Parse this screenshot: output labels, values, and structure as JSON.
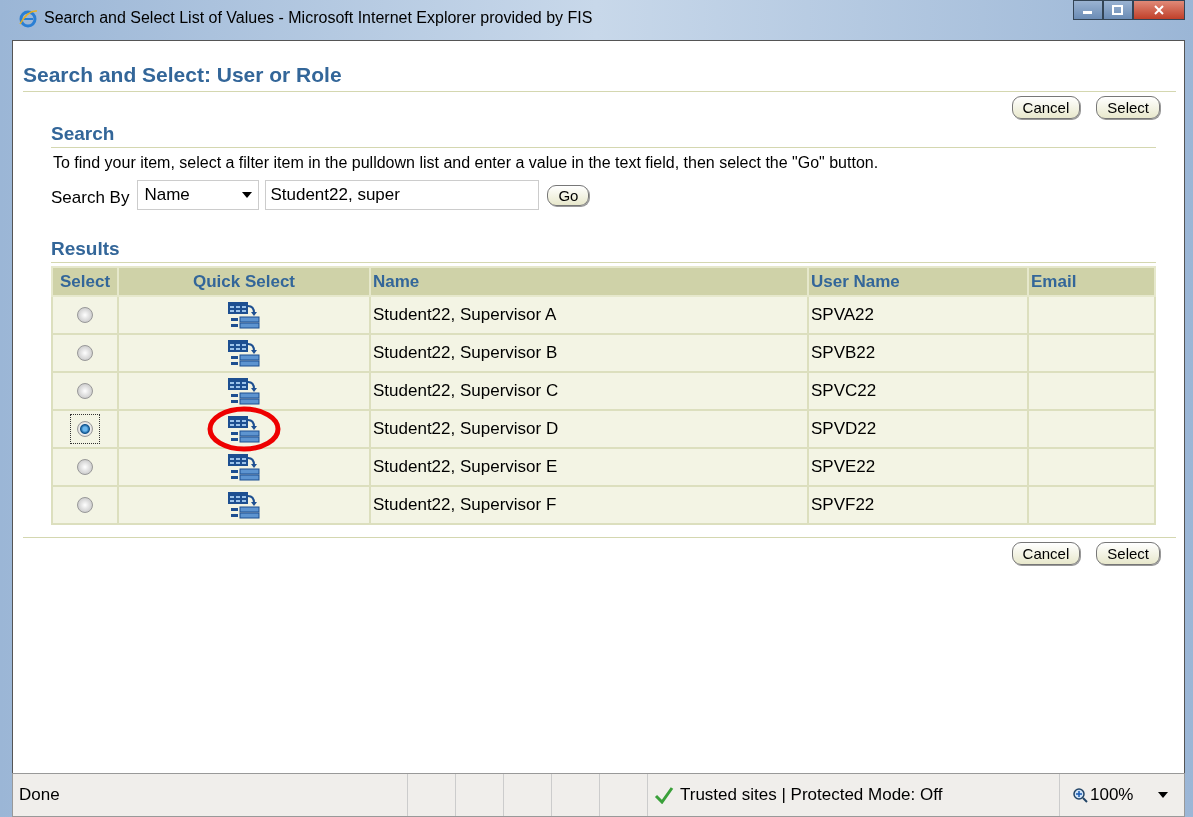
{
  "window": {
    "title": "Search and Select List of Values - Microsoft Internet Explorer provided by FIS"
  },
  "page": {
    "title": "Search and Select: User or Role",
    "buttons": [
      {
        "label": "Cancel"
      },
      {
        "label": "Select"
      }
    ]
  },
  "search": {
    "heading": "Search",
    "instructions": "To find your item, select a filter item in the pulldown list and enter a value in the text field, then select the \"Go\" button.",
    "label": "Search By",
    "filter": "Name",
    "value": "Student22, super",
    "go": "Go"
  },
  "results": {
    "heading": "Results",
    "columns": [
      "Select",
      "Quick Select",
      "Name",
      "User Name",
      "Email"
    ],
    "rows": [
      {
        "name": "Student22, Supervisor A",
        "user_name": "SPVA22",
        "selected": false,
        "circled": false
      },
      {
        "name": "Student22, Supervisor B",
        "user_name": "SPVB22",
        "selected": false,
        "circled": false
      },
      {
        "name": "Student22, Supervisor C",
        "user_name": "SPVC22",
        "selected": false,
        "circled": false
      },
      {
        "name": "Student22, Supervisor D",
        "user_name": "SPVD22",
        "selected": true,
        "circled": true
      },
      {
        "name": "Student22, Supervisor E",
        "user_name": "SPVE22",
        "selected": false,
        "circled": false
      },
      {
        "name": "Student22, Supervisor F",
        "user_name": "SPVF22",
        "selected": false,
        "circled": false
      }
    ]
  },
  "footer_buttons": [
    {
      "label": "Cancel"
    },
    {
      "label": "Select"
    }
  ],
  "status_bar": {
    "status": "Done",
    "zone": "Trusted sites | Protected Mode: Off",
    "zoom": "100%"
  }
}
